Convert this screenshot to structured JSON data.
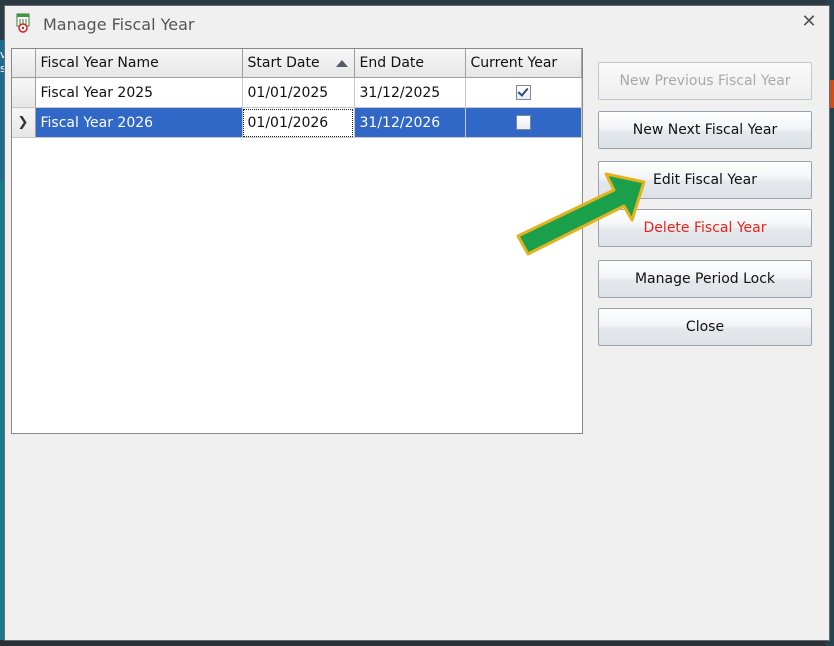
{
  "window": {
    "title": "Manage Fiscal Year",
    "close_glyph": "✕"
  },
  "background": {
    "left_text": "v\ns"
  },
  "grid": {
    "columns": [
      "Fiscal Year Name",
      "Start Date",
      "End Date",
      "Current Year"
    ],
    "sorted_column": "Start Date",
    "sort_direction": "ascending",
    "rows": [
      {
        "name": "Fiscal Year 2025",
        "start": "01/01/2025",
        "end": "31/12/2025",
        "current": true,
        "selected": false
      },
      {
        "name": "Fiscal Year 2026",
        "start": "01/01/2026",
        "end": "31/12/2026",
        "current": false,
        "selected": true
      }
    ]
  },
  "buttons": {
    "new_previous": "New Previous Fiscal Year",
    "new_next": "New Next Fiscal Year",
    "edit": "Edit Fiscal Year",
    "delete": "Delete Fiscal Year",
    "period_lock": "Manage Period Lock",
    "close": "Close"
  },
  "colors": {
    "selection": "#3167c6",
    "delete_text": "#e8241c",
    "arrow_fill": "#1aa04a",
    "arrow_border": "#e3b21c"
  },
  "icons": {
    "app": "fiscal-calendar-icon",
    "close": "close-icon",
    "row_indicator": "row-selector-arrow-icon",
    "sort": "sort-ascending-icon"
  }
}
